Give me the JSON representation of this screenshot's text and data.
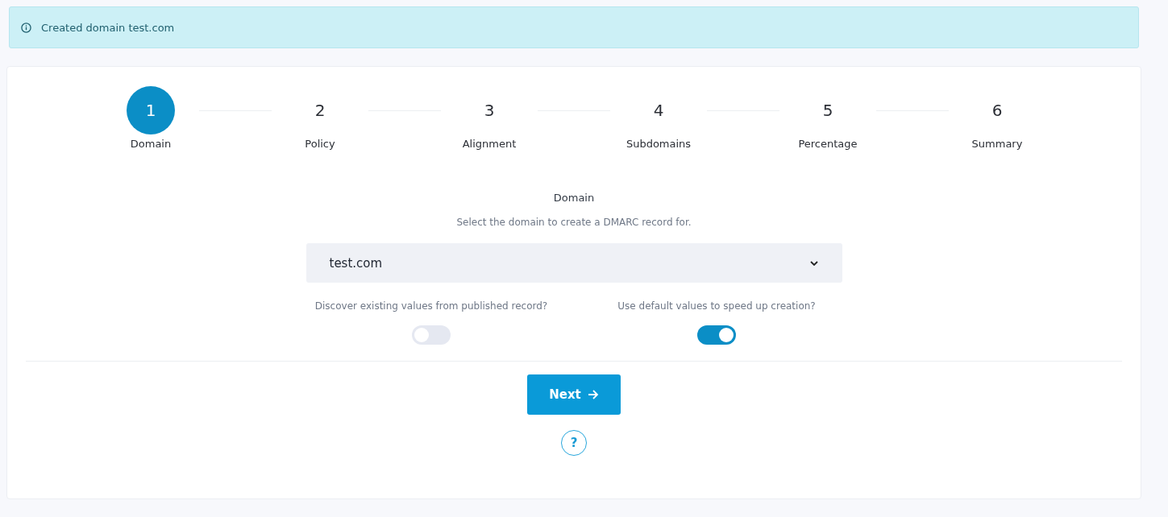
{
  "alert": {
    "text": "Created domain test.com"
  },
  "steps": [
    {
      "number": "1",
      "label": "Domain",
      "selected": true
    },
    {
      "number": "2",
      "label": "Policy",
      "selected": false
    },
    {
      "number": "3",
      "label": "Alignment",
      "selected": false
    },
    {
      "number": "4",
      "label": "Subdomains",
      "selected": false
    },
    {
      "number": "5",
      "label": "Percentage",
      "selected": false
    },
    {
      "number": "6",
      "label": "Summary",
      "selected": false
    }
  ],
  "section": {
    "title": "Domain",
    "description": "Select the domain to create a DMARC record for."
  },
  "domain_select": {
    "value": "test.com"
  },
  "toggles": [
    {
      "label": "Discover existing values from published record?",
      "on": false
    },
    {
      "label": "Use default values to speed up creation?",
      "on": true
    }
  ],
  "next_button": {
    "label": "Next"
  },
  "help_button": {
    "label": "?"
  }
}
